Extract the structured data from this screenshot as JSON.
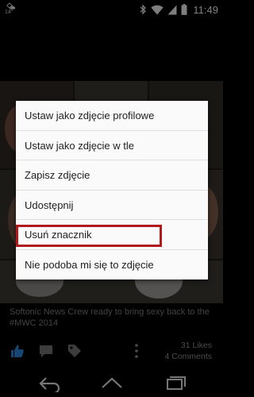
{
  "status_bar": {
    "temperature": "14°",
    "time": "11:49",
    "icons": [
      "weather-icon",
      "bluetooth-icon",
      "wifi-icon",
      "signal-icon",
      "battery-icon"
    ]
  },
  "post": {
    "caption": "Softonic News Crew ready to bring sexy back to the #MWC 2014",
    "likes": "31 Likes",
    "comments": "4 Comments",
    "action_icons": [
      "like-icon",
      "comment-icon",
      "tag-icon",
      "overflow-icon"
    ]
  },
  "context_menu": {
    "items": [
      "Ustaw jako zdjęcie profilowe",
      "Ustaw jako zdjęcie w tle",
      "Zapisz zdjęcie",
      "Udostępnij",
      "Usuń znacznik",
      "Nie podoba mi się to zdjęcie"
    ],
    "highlighted_item": "Usuń znacznik",
    "highlight_color": "#b11a1d"
  },
  "nav_bar": {
    "icons": [
      "back-icon",
      "home-icon",
      "recents-icon"
    ]
  },
  "colors": {
    "accent_blue": "#2f7fd1",
    "background": "#000000",
    "menu_background": "#fafafa"
  }
}
